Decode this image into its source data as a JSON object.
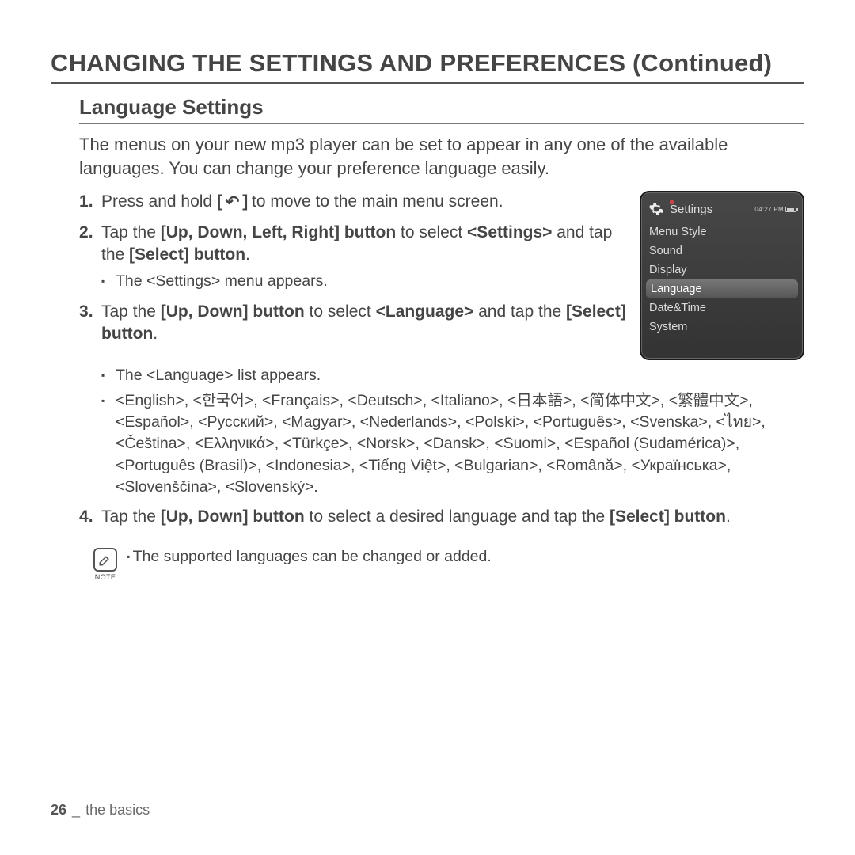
{
  "page_title": "CHANGING THE SETTINGS AND PREFERENCES (Continued)",
  "section_title": "Language Settings",
  "intro": "The menus on your new mp3 player can be set to appear in any one of the available languages. You can change your preference language easily.",
  "steps": {
    "s1": {
      "pre": "Press and hold ",
      "key_open": "[ ",
      "key_glyph": "↶",
      "key_close": " ]",
      "post": " to move to the main menu screen."
    },
    "s2": {
      "a": "Tap the ",
      "b1": "[Up, Down, Left, Right] button",
      "c": " to select ",
      "b2": "<Settings>",
      "d": " and tap the ",
      "b3": "[Select] button",
      "e": ".",
      "sub1": "The <Settings> menu appears."
    },
    "s3": {
      "a": "Tap the ",
      "b1": "[Up, Down] button",
      "c": " to select ",
      "b2": "<Language>",
      "d": " and tap the ",
      "b3": "[Select] button",
      "e": ".",
      "sub1": "The <Language> list appears.",
      "sub2": "<English>, <한국어>, <Français>, <Deutsch>, <Italiano>, <日本語>, <简体中文>, <繁體中文>, <Español>, <Русский>, <Magyar>, <Nederlands>, <Polski>, <Português>, <Svenska>, <ไทย>, <Čeština>, <Ελληνικά>, <Türkçe>, <Norsk>, <Dansk>, <Suomi>, <Español (Sudamérica)>, <Português (Brasil)>, <Indonesia>, <Tiếng Việt>, <Bulgarian>, <Română>, <Українська>, <Slovenščina>, <Slovenský>."
    },
    "s4": {
      "a": "Tap the ",
      "b1": "[Up, Down] button",
      "c": " to select a desired language and tap the ",
      "b2": "[Select] button",
      "d": "."
    }
  },
  "note": {
    "label": "NOTE",
    "text": "The supported languages can be changed or added."
  },
  "device": {
    "title": "Settings",
    "time": "04:27 PM",
    "items": [
      "Menu Style",
      "Sound",
      "Display",
      "Language",
      "Date&Time",
      "System"
    ],
    "selected_index": 3
  },
  "footer": {
    "page": "26",
    "sep": "_",
    "section": "the basics"
  }
}
